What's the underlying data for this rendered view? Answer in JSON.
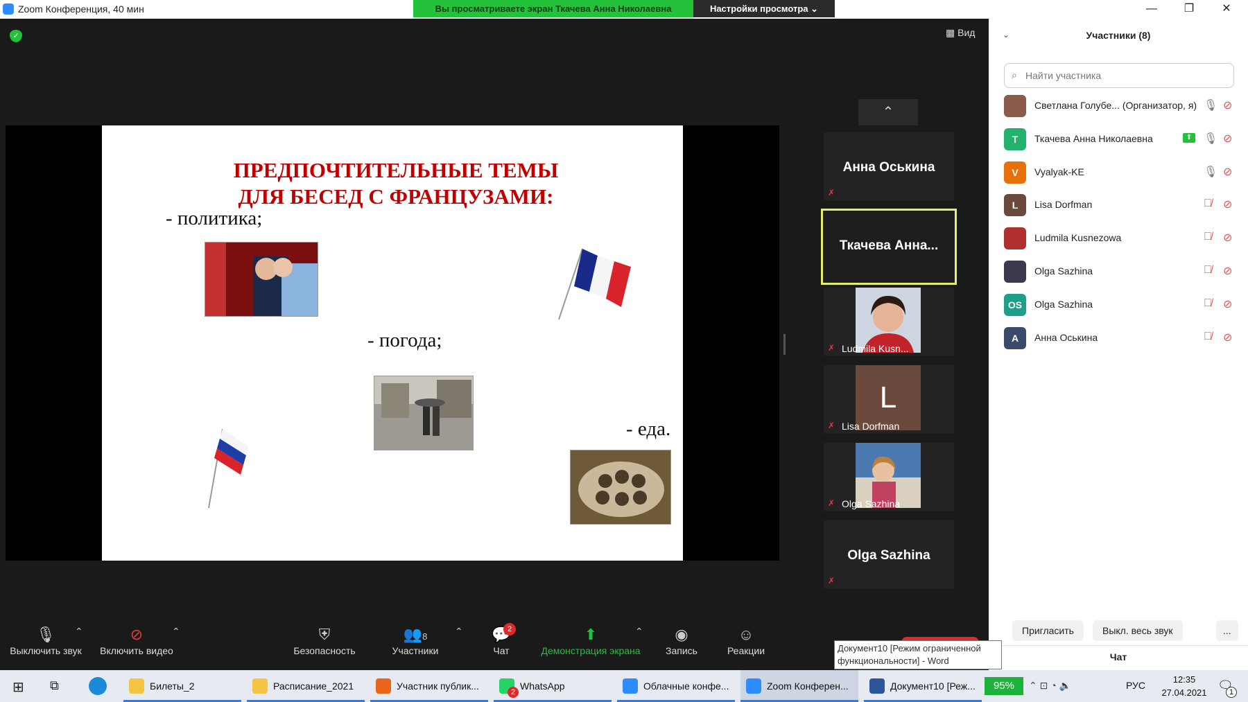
{
  "titlebar": {
    "app_title": "Zoom Конференция, 40 мин",
    "share_banner": "Вы просматриваете экран Ткачева Анна Николаевна",
    "view_settings": "Настройки просмотра ⌄",
    "min": "—",
    "max": "❐",
    "close": "✕"
  },
  "main": {
    "view_label": "Вид"
  },
  "slide": {
    "title_line1": "ПРЕДПОЧТИТЕЛЬНЫЕ ТЕМЫ",
    "title_line2": "ДЛЯ БЕСЕД С ФРАНЦУЗАМИ:",
    "item1": "-   политика;",
    "item2": "- погода;",
    "item3": "- еда."
  },
  "thumbs": [
    {
      "name": "Анна Оськина",
      "type": "name-only"
    },
    {
      "name": "Ткачева  Анна...",
      "type": "active"
    },
    {
      "name": "Ludmila Kusn...",
      "type": "video"
    },
    {
      "name": "Lisa Dorfman",
      "initial": "L",
      "type": "avatar"
    },
    {
      "name": "Olga Sazhina",
      "type": "video"
    },
    {
      "name": "Olga Sazhina",
      "type": "name-only"
    }
  ],
  "toolbar": {
    "mute": "Выключить звук",
    "video": "Включить видео",
    "security": "Безопасность",
    "participants": "Участники",
    "participants_count": "8",
    "chat": "Чат",
    "chat_badge": "2",
    "share": "Демонстрация экрана",
    "record": "Запись",
    "reactions": "Реакции"
  },
  "panel": {
    "title": "Участники (8)",
    "search_placeholder": "Найти участника",
    "participants": [
      {
        "name": "Светлана Голубе... (Организатор, я)",
        "avatar": "photo",
        "color": "#8a5a4a"
      },
      {
        "name": "Ткачева Анна Николаевна",
        "avatar": "Т",
        "color": "#23b26d",
        "sharing": true
      },
      {
        "name": "Vyalyak-KE",
        "avatar": "V",
        "color": "#e8700a"
      },
      {
        "name": "Lisa Dorfman",
        "avatar": "L",
        "color": "#6b4a3e"
      },
      {
        "name": "Ludmila Kusnezowa",
        "avatar": "photo",
        "color": "#b03030"
      },
      {
        "name": "Olga Sazhina",
        "avatar": "photo",
        "color": "#3a3a4a"
      },
      {
        "name": "Olga Sazhina",
        "avatar": "OS",
        "color": "#1f9e8a"
      },
      {
        "name": "Анна Оськина",
        "avatar": "А",
        "color": "#3a4a6a"
      }
    ],
    "invite": "Пригласить",
    "mute_all": "Выкл. весь звук",
    "more": "...",
    "chat_title": "Чат"
  },
  "tooltip": {
    "line1": "Документ10 [Режим ограниченной",
    "line2": "функциональности] - Word"
  },
  "taskbar": {
    "items": [
      "Билеты_2",
      "Расписание_2021",
      "Участник публик...",
      "WhatsApp",
      "Облачные конфе...",
      "Zoom Конферен...",
      "Документ10 [Реж..."
    ],
    "whatsapp_badge": "2",
    "battery": "95%",
    "lang": "РУС",
    "time": "12:35",
    "date": "27.04.2021",
    "notif_badge": "1"
  }
}
